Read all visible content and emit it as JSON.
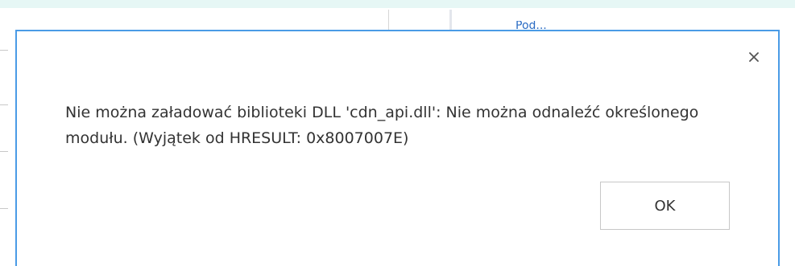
{
  "background": {
    "link_text": "Pod..."
  },
  "dialog": {
    "close_icon": "close-icon",
    "message": "Nie można załadować biblioteki DLL 'cdn_api.dll': Nie można odnaleźć określonego modułu. (Wyjątek od HRESULT: 0x8007007E)",
    "ok_label": "OK"
  },
  "colors": {
    "dialog_border": "#4a9be6",
    "top_band": "#e6f7f5",
    "text": "#333333",
    "button_border": "#c7c7c7",
    "link": "#2b6cc4"
  }
}
